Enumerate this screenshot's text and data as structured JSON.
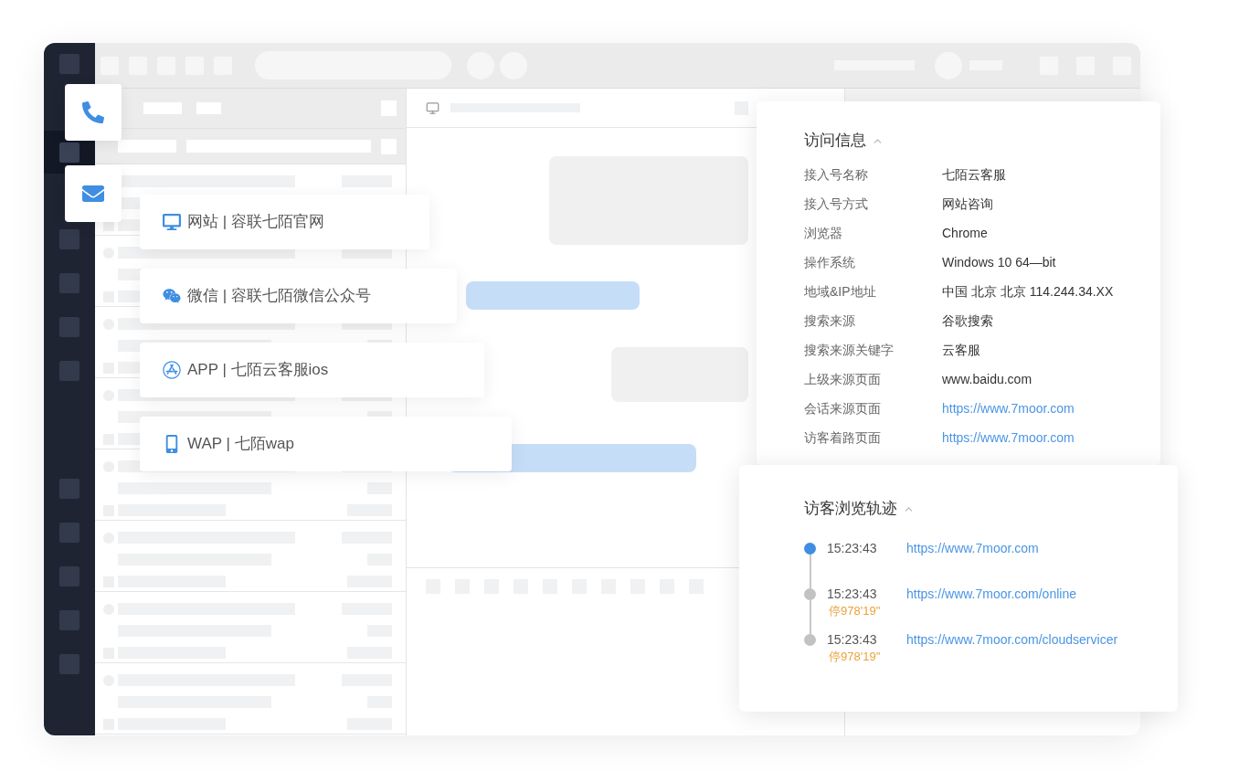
{
  "contact_buttons": [
    {
      "kind": "phone"
    },
    {
      "kind": "mail"
    }
  ],
  "channels": [
    {
      "kind": "web",
      "label": "网站 | 容联七陌官网"
    },
    {
      "kind": "wechat",
      "label": "微信 | 容联七陌微信公众号"
    },
    {
      "kind": "app",
      "label": "APP | 七陌云客服ios"
    },
    {
      "kind": "wap",
      "label": "WAP | 七陌wap"
    }
  ],
  "visit_info": {
    "title": "访问信息",
    "expanded": true,
    "rows": [
      {
        "label": "接入号名称",
        "value": "七陌云客服",
        "kind": "text"
      },
      {
        "label": "接入号方式",
        "value": "网站咨询",
        "kind": "text"
      },
      {
        "label": "浏览器",
        "value": "Chrome",
        "kind": "text"
      },
      {
        "label": "操作系统",
        "value": "Windows 10 64—bit",
        "kind": "text"
      },
      {
        "label": "地域&IP地址",
        "value": "中国 北京 北京 114.244.34.XX",
        "kind": "text"
      },
      {
        "label": "搜索来源",
        "value": "谷歌搜索",
        "kind": "text"
      },
      {
        "label": "搜索来源关键字",
        "value": "云客服",
        "kind": "text"
      },
      {
        "label": "上级来源页面",
        "value": "www.baidu.com",
        "kind": "text"
      },
      {
        "label": "会话来源页面",
        "value": "https://www.7moor.com",
        "kind": "link"
      },
      {
        "label": "访客着路页面",
        "value": "https://www.7moor.com",
        "kind": "link"
      }
    ]
  },
  "browse_trail": {
    "title": "访客浏览轨迹",
    "expanded": true,
    "items": [
      {
        "time": "15:23:43",
        "url": "https://www.7moor.com",
        "current": true
      },
      {
        "time": "15:23:43",
        "stay": "停978'19''",
        "url": "https://www.7moor.com/online",
        "current": false
      },
      {
        "time": "15:23:43",
        "stay": "停978'19''",
        "url": "https://www.7moor.com/cloudservicer",
        "current": false
      }
    ]
  }
}
